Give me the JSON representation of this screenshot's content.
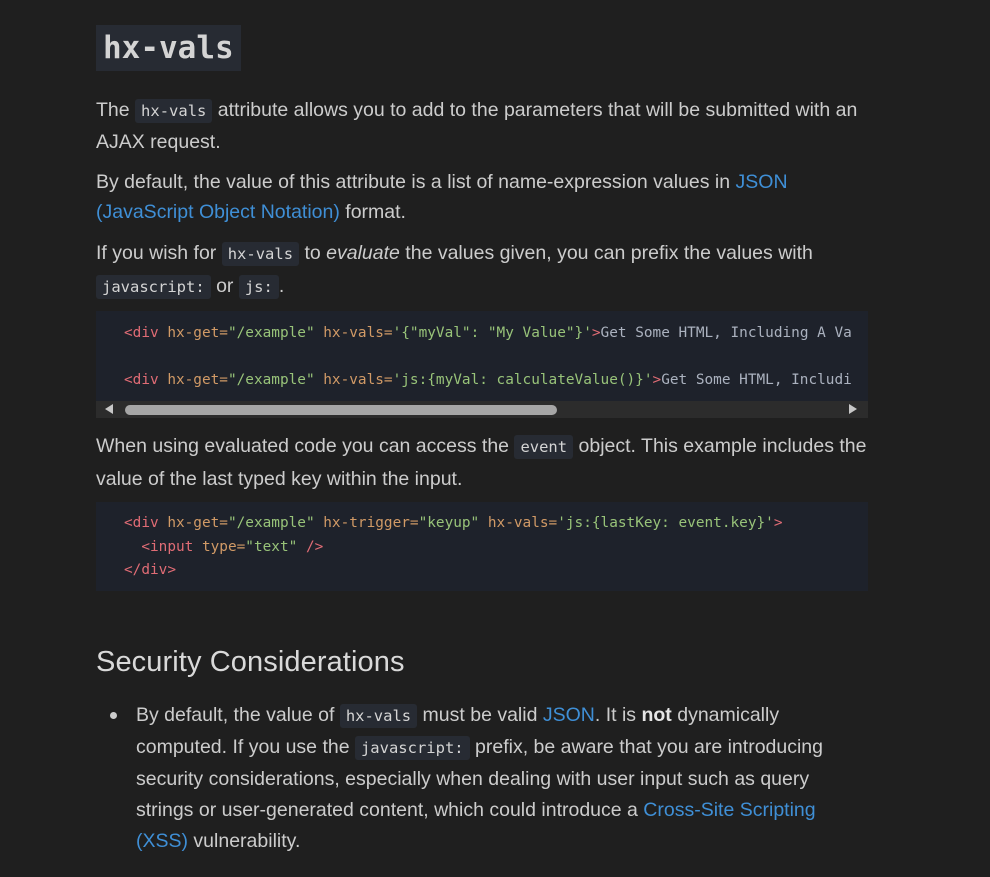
{
  "title": "hx-vals",
  "intro": {
    "pre": "The ",
    "code": "hx-vals",
    "post": " attribute allows you to add to the parameters that will be submitted with an AJAX request."
  },
  "default_para": {
    "pre": "By default, the value of this attribute is a list of name-expression values in ",
    "link": "JSON (JavaScript Object Notation)",
    "post": " format."
  },
  "evaluate_para": {
    "pre": "If you wish for ",
    "code1": "hx-vals",
    "mid1": " to ",
    "em": "evaluate",
    "mid2": " the values given, you can prefix the values with ",
    "code2": "javascript:",
    "mid3": " or ",
    "code3": "js:",
    "post": "."
  },
  "code_block_1": {
    "lines": [
      {
        "open": "<div",
        "attr1": " hx-get=",
        "val1": "\"/example\"",
        "attr2": " hx-vals=",
        "val2": "'{\"myVal\": \"My Value\"}'",
        "close": ">",
        "text": "Get Some HTML, Including A Va"
      },
      {
        "open": "<div",
        "attr1": " hx-get=",
        "val1": "\"/example\"",
        "attr2": " hx-vals=",
        "val2": "'js:{myVal: calculateValue()}'",
        "close": ">",
        "text": "Get Some HTML, Includi"
      }
    ]
  },
  "event_para": {
    "pre": "When using evaluated code you can access the ",
    "code": "event",
    "post": " object. This example includes the value of the last typed key within the input."
  },
  "code_block_2": {
    "line1": {
      "open": "<div",
      "attr1": " hx-get=",
      "val1": "\"/example\"",
      "attr2": " hx-trigger=",
      "val2": "\"keyup\"",
      "attr3": " hx-vals=",
      "val3": "'js:{lastKey: event.key}'",
      "close": ">"
    },
    "line2": {
      "indent": "  ",
      "open": "<input",
      "attr1": " type=",
      "val1": "\"text\"",
      "close": " />"
    },
    "line3": {
      "close_tag": "</div>"
    }
  },
  "security": {
    "heading": "Security Considerations",
    "item": {
      "pre": "By default, the value of ",
      "code1": "hx-vals",
      "mid1": " must be valid ",
      "link1": "JSON",
      "mid2": ". It is ",
      "strong": "not",
      "mid3": " dynamically computed. If you use the ",
      "code2": "javascript:",
      "mid4": " prefix, be aware that you are introducing security considerations, especially when dealing with user input such as query strings or user-generated content, which could introduce a ",
      "link2": "Cross-Site Scripting (XSS)",
      "post": " vulnerability."
    }
  },
  "colors": {
    "background": "#1f1f1f",
    "text": "#cccccc",
    "link": "#3f8fd6",
    "code_bg": "#272b33",
    "code_block_bg": "#1e222b",
    "tag": "#e06c75",
    "attr": "#d19a66",
    "string": "#98c379"
  }
}
